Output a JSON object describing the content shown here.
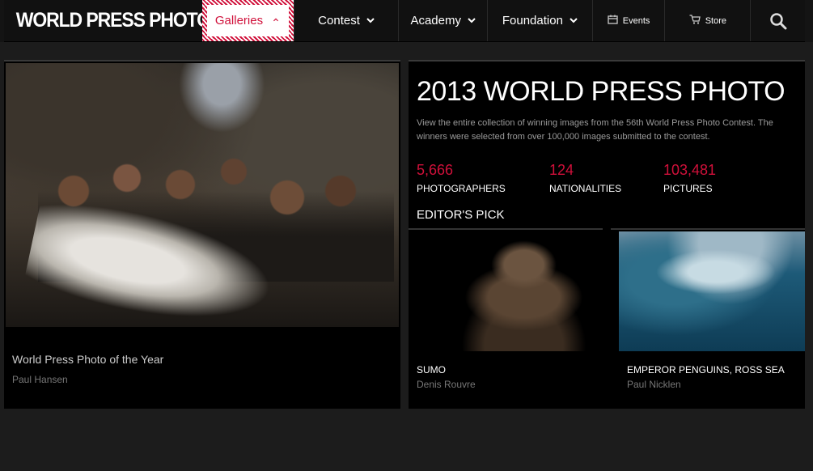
{
  "header": {
    "logo": "WORLD PRESS PHOTO",
    "nav": [
      {
        "label": "Galleries",
        "icon": "chevron-up-icon",
        "active": true
      },
      {
        "label": "Contest",
        "icon": "chevron-down-icon"
      },
      {
        "label": "Academy",
        "icon": "chevron-down-icon"
      },
      {
        "label": "Foundation",
        "icon": "chevron-down-icon"
      }
    ],
    "events_label": "Events",
    "store_label": "Store",
    "chevron_up_glyph": "⌃",
    "chevron_down_glyph": "⌄"
  },
  "hero": {
    "caption": "World Press Photo of the Year",
    "credit": "Paul Hansen"
  },
  "info": {
    "title": "2013 WORLD PRESS PHOTO",
    "description": "View the entire collection of winning images from the 56th World Press Photo Contest. The winners were selected from over 100,000 images submitted to the contest.",
    "stats": [
      {
        "value": "5,666",
        "label": "PHOTOGRAPHERS"
      },
      {
        "value": "124",
        "label": "NATIONALITIES"
      },
      {
        "value": "103,481",
        "label": "PICTURES"
      }
    ],
    "editors_pick_heading": "EDITOR'S PICK",
    "picks": [
      {
        "title": "SUMO",
        "author": "Denis Rouvre"
      },
      {
        "title": "EMPEROR PENGUINS, ROSS SEA",
        "author": "Paul Nicklen"
      }
    ]
  },
  "colors": {
    "accent": "#d0103a",
    "background": "#1c1c1c",
    "panel": "#000000"
  }
}
